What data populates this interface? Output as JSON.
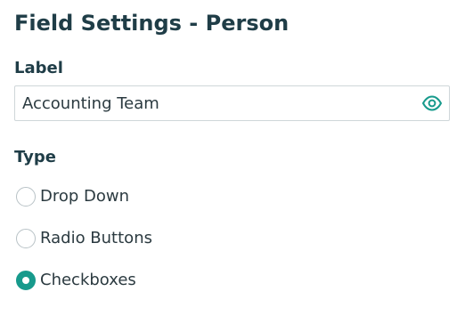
{
  "page": {
    "title": "Field Settings - Person"
  },
  "label_section": {
    "heading": "Label",
    "value": "Accounting Team",
    "visibility_icon": "eye-icon"
  },
  "type_section": {
    "heading": "Type",
    "options": [
      {
        "label": "Drop Down",
        "selected": false
      },
      {
        "label": "Radio Buttons",
        "selected": false
      },
      {
        "label": "Checkboxes",
        "selected": true
      }
    ]
  },
  "colors": {
    "accent": "#179a8c",
    "heading": "#1f3d47",
    "border": "#cfd6d9"
  }
}
